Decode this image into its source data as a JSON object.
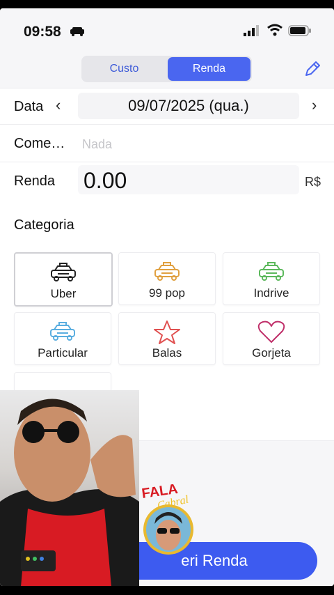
{
  "status": {
    "time": "09:58"
  },
  "segmented": {
    "custo": "Custo",
    "renda": "Renda"
  },
  "form": {
    "date_label": "Data",
    "date_value": "09/07/2025 (qua.)",
    "comment_label": "Come…",
    "comment_placeholder": "Nada",
    "income_label": "Renda",
    "income_value": "0.00",
    "currency": "R$"
  },
  "category": {
    "title": "Categoria",
    "items": [
      {
        "label": "Uber",
        "icon": "taxi-icon",
        "color": "#222222",
        "selected": true
      },
      {
        "label": "99 pop",
        "icon": "taxi-icon",
        "color": "#e0a040"
      },
      {
        "label": "Indrive",
        "icon": "taxi-icon",
        "color": "#5cb85c"
      },
      {
        "label": "Particular",
        "icon": "taxi-icon",
        "color": "#5aaee0"
      },
      {
        "label": "Balas",
        "icon": "star-icon",
        "color": "#e05050"
      },
      {
        "label": "Gorjeta",
        "icon": "heart-icon",
        "color": "#c0306a"
      }
    ]
  },
  "submit": {
    "label": "eri Renda"
  },
  "overlay": {
    "badge_text_1": "FALA",
    "badge_text_2": "Cabral"
  },
  "colors": {
    "accent": "#4a66f0",
    "accent_dark": "#3d5bf0"
  }
}
